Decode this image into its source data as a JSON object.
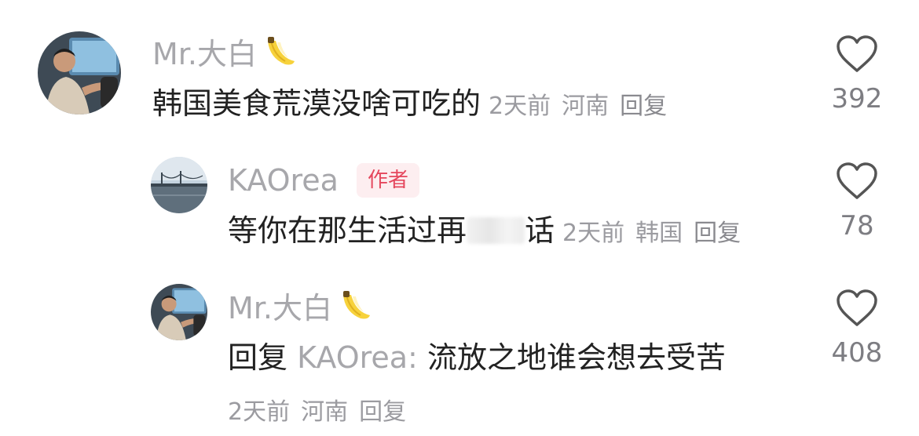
{
  "comments": [
    {
      "username": "Mr.大白",
      "text": "韩国美食荒漠没啥可吃的",
      "time": "2天前",
      "location": "河南",
      "reply_label": "回复",
      "likes": "392"
    },
    {
      "username": "KAOrea",
      "badge": "作者",
      "text_visible": "等你在那生活过再",
      "text_after_blur": "话",
      "time": "2天前",
      "location": "韩国",
      "reply_label": "回复",
      "likes": "78"
    },
    {
      "username": "Mr.大白",
      "reply_prefix": "回复",
      "reply_target": "KAOrea:",
      "text": "流放之地谁会想去受苦",
      "time": "2天前",
      "location": "河南",
      "reply_label": "回复",
      "likes": "408"
    }
  ],
  "icons": {
    "emoji": "banana-icon",
    "like": "heart-outline-icon"
  },
  "colors": {
    "username": "#a7a7ab",
    "body_text": "#222222",
    "meta_text": "#9b9ba0",
    "badge_text": "#e5475d",
    "badge_bg": "#fdeef0"
  }
}
